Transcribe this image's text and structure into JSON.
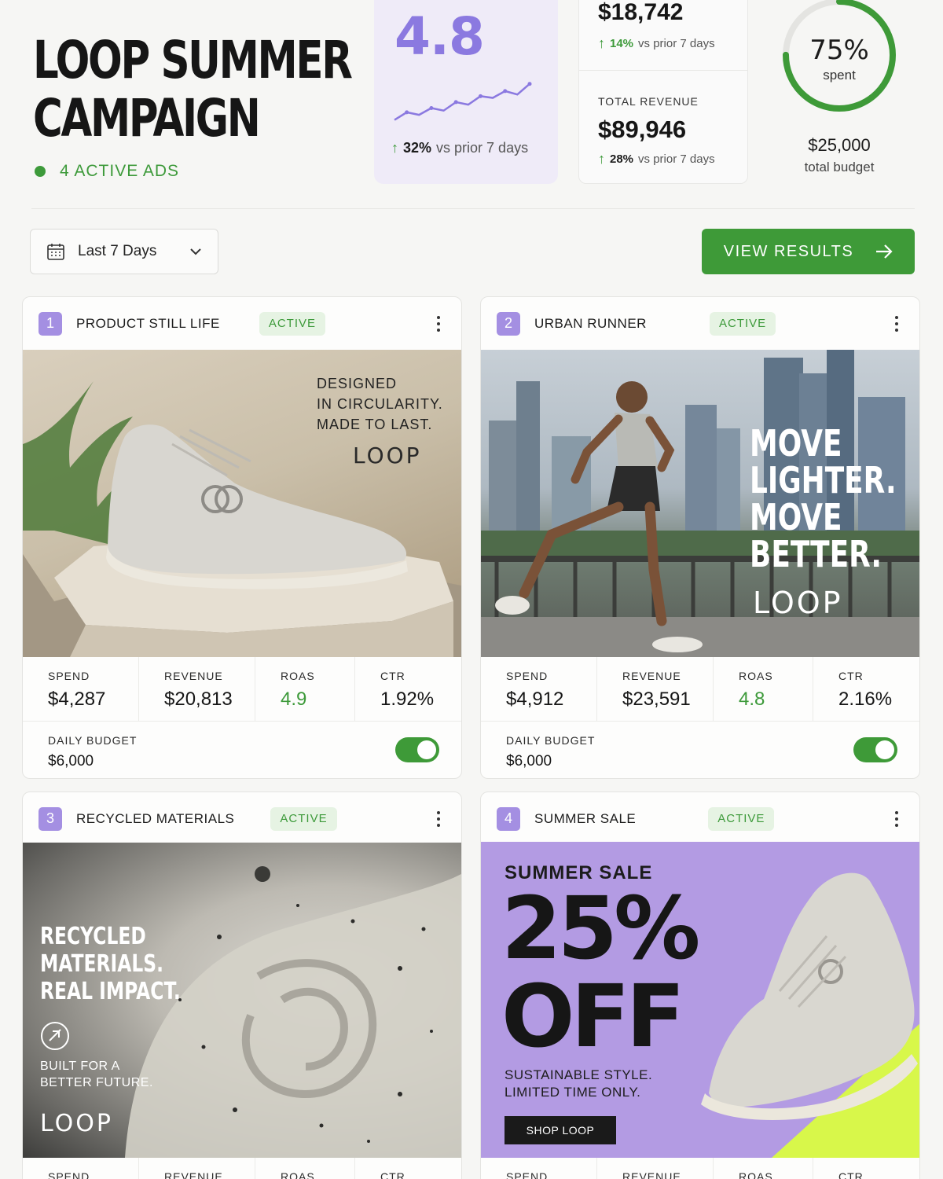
{
  "campaign": {
    "title_line1": "LOOP SUMMER",
    "title_line2": "CAMPAIGN",
    "active_ads": "4 ACTIVE ADS"
  },
  "rating": {
    "value": "4.8",
    "delta_pct": "32%",
    "delta_vs": "vs prior 7 days",
    "trend": [
      0.1,
      0.28,
      0.22,
      0.38,
      0.32,
      0.52,
      0.46,
      0.66,
      0.62,
      0.78,
      0.7,
      0.95
    ]
  },
  "spend_metric": {
    "value": "$18,742",
    "delta_pct": "14%",
    "delta_vs": "vs prior 7 days"
  },
  "revenue_metric": {
    "label": "TOTAL REVENUE",
    "value": "$89,946",
    "delta_pct": "28%",
    "delta_vs": "vs prior 7 days"
  },
  "budget": {
    "spent_pct": "75%",
    "spent_fraction": 0.75,
    "spent_label": "spent",
    "total": "$25,000",
    "total_label": "total budget"
  },
  "controls": {
    "date_range": "Last 7 Days",
    "view_results": "VIEW RESULTS"
  },
  "colors": {
    "accent_green": "#3e9a38",
    "accent_purple": "#8b79e0",
    "badge_purple": "#a48fe2"
  },
  "ads": [
    {
      "number": "1",
      "name": "PRODUCT STILL LIFE",
      "status": "ACTIVE",
      "creative": {
        "line1": "DESIGNED",
        "line2": "IN CIRCULARITY.",
        "line3": "MADE TO LAST.",
        "logo": "LOOP"
      },
      "spend_label": "SPEND",
      "spend": "$4,287",
      "revenue_label": "REVENUE",
      "revenue": "$20,813",
      "roas_label": "ROAS",
      "roas": "4.9",
      "ctr_label": "CTR",
      "ctr": "1.92%",
      "daily_budget_label": "DAILY BUDGET",
      "daily_budget": "$6,000"
    },
    {
      "number": "2",
      "name": "URBAN RUNNER",
      "status": "ACTIVE",
      "creative": {
        "line1": "MOVE",
        "line2": "LIGHTER.",
        "line3": "MOVE",
        "line4": "BETTER.",
        "logo": "LOOP"
      },
      "spend_label": "SPEND",
      "spend": "$4,912",
      "revenue_label": "REVENUE",
      "revenue": "$23,591",
      "roas_label": "ROAS",
      "roas": "4.8",
      "ctr_label": "CTR",
      "ctr": "2.16%",
      "daily_budget_label": "DAILY BUDGET",
      "daily_budget": "$6,000"
    },
    {
      "number": "3",
      "name": "RECYCLED MATERIALS",
      "status": "ACTIVE",
      "creative": {
        "line1": "RECYCLED",
        "line2": "MATERIALS.",
        "line3": "REAL IMPACT.",
        "sub1": "BUILT FOR A",
        "sub2": "BETTER FUTURE.",
        "logo": "LOOP"
      },
      "spend_label": "SPEND",
      "revenue_label": "REVENUE",
      "roas_label": "ROAS",
      "ctr_label": "CTR"
    },
    {
      "number": "4",
      "name": "SUMMER SALE",
      "status": "ACTIVE",
      "creative": {
        "eyebrow": "SUMMER SALE",
        "big1": "25%",
        "big2": "OFF",
        "sub1": "SUSTAINABLE STYLE.",
        "sub2": "LIMITED TIME ONLY.",
        "cta": "SHOP LOOP"
      },
      "spend_label": "SPEND",
      "revenue_label": "REVENUE",
      "roas_label": "ROAS",
      "ctr_label": "CTR"
    }
  ]
}
